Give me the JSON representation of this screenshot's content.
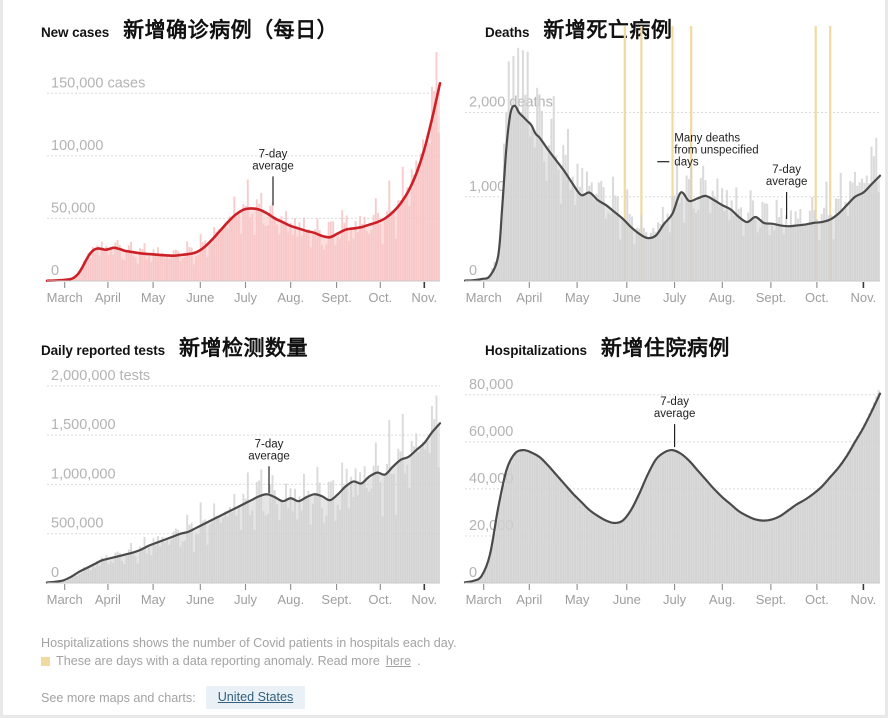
{
  "page": {
    "background": "#ffffff",
    "accent_red": "#cc2027",
    "accent_red_fill": "#f7c3c3",
    "accent_gray": "#4a4a4a",
    "accent_gray_fill": "#cfcfcf",
    "anomaly_color": "#f2d9a0"
  },
  "panels": [
    {
      "id": "new-cases",
      "title_en": "New cases",
      "title_zh": "新增确诊病例（每日）",
      "annotation": "7-day average"
    },
    {
      "id": "deaths",
      "title_en": "Deaths",
      "title_zh": "新增死亡病例",
      "annotation": "7-day average",
      "annotation2_line1": "Many deaths",
      "annotation2_line2": "from unspecified",
      "annotation2_line3": "days"
    },
    {
      "id": "daily-reported-tests",
      "title_en": "Daily reported tests",
      "title_zh": "新增检测数量",
      "annotation": "7-day average"
    },
    {
      "id": "hospitalizations",
      "title_en": "Hospitalizations",
      "title_zh": "新增住院病例",
      "annotation": "7-day average"
    }
  ],
  "footer": {
    "note1": "Hospitalizations shows the number of Covid patients in hospitals each day.",
    "note2_before": "These are days with a data reporting anomaly. Read more ",
    "note2_link": "here",
    "note2_after": ".",
    "see_more_label": "See more maps and charts:",
    "region_button": "United States"
  },
  "chart_data": [
    {
      "type": "area",
      "id": "new-cases",
      "title": "New cases  新增确诊病例（每日）",
      "xlabel": "",
      "ylabel": "cases",
      "unit_suffix": "cases",
      "ylim": [
        0,
        175000
      ],
      "yticks": [
        0,
        50000,
        100000,
        150000
      ],
      "ytick_labels": [
        "0",
        "50,000",
        "100,000",
        "150,000 cases"
      ],
      "grid": true,
      "legend": "none",
      "line_color": "#cc2027",
      "fill_color": "#f7c3c3",
      "categories": [
        "March",
        "April",
        "May",
        "June",
        "July",
        "Aug.",
        "Sept.",
        "Oct.",
        "Nov."
      ],
      "tick_x_fraction": [
        0.045,
        0.155,
        0.27,
        0.39,
        0.505,
        0.62,
        0.737,
        0.848,
        0.96
      ],
      "x": [
        0,
        0.02,
        0.04,
        0.06,
        0.07,
        0.08,
        0.09,
        0.1,
        0.11,
        0.12,
        0.13,
        0.14,
        0.15,
        0.16,
        0.17,
        0.18,
        0.19,
        0.2,
        0.22,
        0.24,
        0.26,
        0.28,
        0.3,
        0.32,
        0.34,
        0.36,
        0.38,
        0.4,
        0.42,
        0.44,
        0.46,
        0.48,
        0.5,
        0.52,
        0.54,
        0.56,
        0.58,
        0.6,
        0.62,
        0.64,
        0.66,
        0.68,
        0.7,
        0.72,
        0.74,
        0.76,
        0.78,
        0.8,
        0.82,
        0.84,
        0.86,
        0.88,
        0.9,
        0.92,
        0.94,
        0.96,
        0.98,
        1.0
      ],
      "avg_values": [
        200,
        400,
        800,
        1500,
        3000,
        6000,
        11000,
        17000,
        22000,
        25000,
        26000,
        25500,
        25000,
        25800,
        26500,
        26000,
        25000,
        24000,
        23000,
        22000,
        21500,
        21000,
        20500,
        20200,
        20800,
        21500,
        23000,
        27000,
        33000,
        40000,
        47000,
        53000,
        57000,
        58000,
        57000,
        54000,
        50000,
        47000,
        44000,
        42000,
        40000,
        38500,
        36000,
        35000,
        38000,
        41000,
        42000,
        43000,
        45000,
        47000,
        50000,
        55000,
        62000,
        72000,
        86000,
        105000,
        130000,
        158000
      ],
      "bar_values": [
        180,
        350,
        900,
        1600,
        3200,
        6500,
        11500,
        18000,
        23000,
        27000,
        24000,
        27500,
        23000,
        28000,
        25000,
        27500,
        22000,
        26000,
        21000,
        24000,
        20000,
        23500,
        19000,
        22000,
        21000,
        24000,
        22000,
        30000,
        31000,
        44000,
        45000,
        58000,
        54000,
        63000,
        52000,
        58000,
        47000,
        51000,
        41000,
        46000,
        37000,
        42000,
        33000,
        39000,
        40000,
        46000,
        39000,
        47000,
        43000,
        52000,
        47000,
        60000,
        58000,
        80000,
        82000,
        112000,
        128000,
        163000
      ]
    },
    {
      "type": "area",
      "id": "deaths",
      "title": "Deaths  新增死亡病例",
      "xlabel": "",
      "ylabel": "deaths",
      "unit_suffix": "deaths",
      "ylim": [
        0,
        2600
      ],
      "yticks": [
        0,
        1000,
        2000
      ],
      "ytick_labels": [
        "0",
        "1,000",
        "2,000 deaths"
      ],
      "grid": true,
      "legend": "none",
      "line_color": "#4a4a4a",
      "fill_color": "#cfcfcf",
      "categories": [
        "March",
        "April",
        "May",
        "June",
        "July",
        "Aug.",
        "Sept.",
        "Oct.",
        "Nov."
      ],
      "tick_x_fraction": [
        0.045,
        0.155,
        0.27,
        0.39,
        0.505,
        0.62,
        0.737,
        0.848,
        0.96
      ],
      "anomaly_x": [
        0.385,
        0.425,
        0.5,
        0.545,
        0.845,
        0.88
      ],
      "x": [
        0,
        0.02,
        0.04,
        0.06,
        0.08,
        0.09,
        0.1,
        0.11,
        0.12,
        0.13,
        0.14,
        0.15,
        0.16,
        0.17,
        0.18,
        0.2,
        0.22,
        0.24,
        0.26,
        0.28,
        0.3,
        0.32,
        0.34,
        0.36,
        0.38,
        0.4,
        0.42,
        0.44,
        0.46,
        0.48,
        0.5,
        0.52,
        0.54,
        0.56,
        0.58,
        0.6,
        0.62,
        0.64,
        0.66,
        0.68,
        0.7,
        0.72,
        0.74,
        0.76,
        0.78,
        0.8,
        0.82,
        0.84,
        0.86,
        0.88,
        0.9,
        0.92,
        0.94,
        0.96,
        0.98,
        1.0
      ],
      "avg_values": [
        5,
        10,
        25,
        60,
        300,
        900,
        1600,
        2000,
        2080,
        2000,
        1950,
        1900,
        1850,
        1750,
        1700,
        1560,
        1430,
        1300,
        1150,
        1020,
        1050,
        960,
        900,
        820,
        740,
        640,
        560,
        510,
        540,
        680,
        800,
        1050,
        950,
        980,
        1010,
        960,
        900,
        850,
        760,
        700,
        760,
        690,
        680,
        660,
        650,
        660,
        670,
        690,
        700,
        730,
        800,
        900,
        1000,
        1050,
        1150,
        1250
      ],
      "bar_values": [
        4,
        9,
        30,
        70,
        380,
        1100,
        2200,
        2500,
        2400,
        2450,
        2300,
        2250,
        2000,
        1950,
        1800,
        1700,
        1550,
        1400,
        1250,
        1150,
        1200,
        1050,
        980,
        900,
        820,
        720,
        640,
        580,
        620,
        750,
        880,
        1150,
        1020,
        1060,
        1100,
        1040,
        980,
        920,
        840,
        780,
        840,
        760,
        760,
        740,
        730,
        740,
        760,
        780,
        800,
        830,
        900,
        1000,
        1150,
        1200,
        1350,
        1450
      ]
    },
    {
      "type": "area",
      "id": "daily-reported-tests",
      "title": "Daily reported tests  新增检测数量",
      "xlabel": "",
      "ylabel": "tests",
      "unit_suffix": "tests",
      "ylim": [
        0,
        2100000
      ],
      "yticks": [
        0,
        500000,
        1000000,
        1500000,
        2000000
      ],
      "ytick_labels": [
        "0",
        "500,000",
        "1,000,000",
        "1,500,000",
        "2,000,000 tests"
      ],
      "grid": true,
      "legend": "none",
      "line_color": "#4a4a4a",
      "fill_color": "#cfcfcf",
      "categories": [
        "March",
        "April",
        "May",
        "June",
        "July",
        "Aug.",
        "Sept.",
        "Oct.",
        "Nov."
      ],
      "tick_x_fraction": [
        0.045,
        0.155,
        0.27,
        0.39,
        0.505,
        0.62,
        0.737,
        0.848,
        0.96
      ],
      "x": [
        0,
        0.02,
        0.04,
        0.06,
        0.08,
        0.1,
        0.12,
        0.14,
        0.16,
        0.18,
        0.2,
        0.22,
        0.24,
        0.26,
        0.28,
        0.3,
        0.32,
        0.34,
        0.36,
        0.38,
        0.4,
        0.42,
        0.44,
        0.46,
        0.48,
        0.5,
        0.52,
        0.54,
        0.56,
        0.58,
        0.6,
        0.62,
        0.64,
        0.66,
        0.68,
        0.7,
        0.72,
        0.74,
        0.76,
        0.78,
        0.8,
        0.82,
        0.84,
        0.86,
        0.88,
        0.9,
        0.92,
        0.94,
        0.96,
        0.98,
        1.0
      ],
      "avg_values": [
        5000,
        12000,
        25000,
        60000,
        110000,
        150000,
        190000,
        230000,
        250000,
        270000,
        290000,
        310000,
        340000,
        380000,
        410000,
        440000,
        470000,
        500000,
        520000,
        560000,
        600000,
        640000,
        680000,
        720000,
        760000,
        800000,
        840000,
        880000,
        900000,
        870000,
        830000,
        860000,
        830000,
        870000,
        900000,
        880000,
        840000,
        900000,
        980000,
        1030000,
        1010000,
        1080000,
        1120000,
        1100000,
        1180000,
        1250000,
        1280000,
        1350000,
        1420000,
        1530000,
        1620000
      ],
      "bar_values": [
        4000,
        11000,
        22000,
        58000,
        105000,
        145000,
        185000,
        225000,
        245000,
        265000,
        285000,
        305000,
        335000,
        375000,
        405000,
        435000,
        465000,
        495000,
        515000,
        555000,
        595000,
        635000,
        675000,
        715000,
        755000,
        795000,
        835000,
        875000,
        895000,
        865000,
        825000,
        855000,
        825000,
        865000,
        895000,
        875000,
        835000,
        895000,
        975000,
        1025000,
        1005000,
        1075000,
        1115000,
        1095000,
        1175000,
        1245000,
        1275000,
        1345000,
        1415000,
        1525000,
        1615000
      ]
    },
    {
      "type": "area",
      "id": "hospitalizations",
      "title": "Hospitalizations  新增住院病例",
      "xlabel": "",
      "ylabel": "",
      "unit_suffix": "",
      "ylim": [
        0,
        88000
      ],
      "yticks": [
        0,
        20000,
        40000,
        60000,
        80000
      ],
      "ytick_labels": [
        "0",
        "20,000",
        "40,000",
        "60,000",
        "80,000"
      ],
      "grid": true,
      "legend": "none",
      "line_color": "#4a4a4a",
      "fill_color": "#cfcfcf",
      "categories": [
        "March",
        "April",
        "May",
        "June",
        "July",
        "Aug.",
        "Sept.",
        "Oct.",
        "Nov."
      ],
      "tick_x_fraction": [
        0.045,
        0.155,
        0.27,
        0.39,
        0.505,
        0.62,
        0.737,
        0.848,
        0.96
      ],
      "x": [
        0,
        0.02,
        0.04,
        0.06,
        0.08,
        0.1,
        0.12,
        0.14,
        0.16,
        0.18,
        0.2,
        0.22,
        0.24,
        0.26,
        0.28,
        0.3,
        0.32,
        0.34,
        0.36,
        0.38,
        0.4,
        0.42,
        0.44,
        0.46,
        0.48,
        0.5,
        0.52,
        0.54,
        0.56,
        0.58,
        0.6,
        0.62,
        0.64,
        0.66,
        0.68,
        0.7,
        0.72,
        0.74,
        0.76,
        0.78,
        0.8,
        0.82,
        0.84,
        0.86,
        0.88,
        0.9,
        0.92,
        0.94,
        0.96,
        0.98,
        1.0
      ],
      "avg_values": [
        300,
        900,
        3000,
        12000,
        32000,
        48000,
        55000,
        56500,
        55500,
        53500,
        50000,
        46000,
        42000,
        38000,
        34500,
        31000,
        28500,
        26500,
        25500,
        26500,
        31000,
        38000,
        46000,
        52500,
        55500,
        56500,
        55000,
        52000,
        48000,
        44000,
        40000,
        36500,
        33500,
        30500,
        28500,
        27000,
        26500,
        27000,
        28500,
        31000,
        33500,
        35500,
        38000,
        41000,
        45000,
        49000,
        54000,
        60000,
        66000,
        73000,
        80500
      ],
      "bar_values": [
        300,
        900,
        3000,
        12000,
        32000,
        48000,
        55000,
        56500,
        55500,
        53500,
        50000,
        46000,
        42000,
        38000,
        34500,
        31000,
        28500,
        26500,
        25500,
        26500,
        31000,
        38000,
        46000,
        52500,
        55500,
        56500,
        55000,
        52000,
        48000,
        44000,
        40000,
        36500,
        33500,
        30500,
        28500,
        27000,
        26500,
        27000,
        28500,
        31000,
        33500,
        35500,
        38000,
        41000,
        45000,
        49000,
        54000,
        60000,
        66000,
        73000,
        82000
      ]
    }
  ]
}
